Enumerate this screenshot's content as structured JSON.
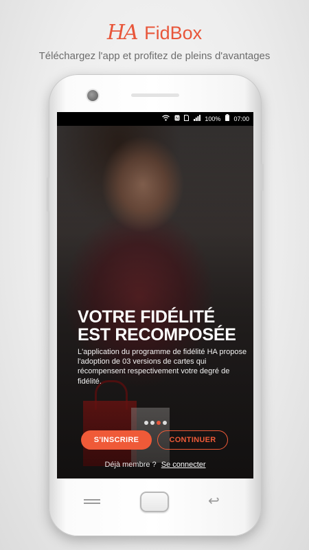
{
  "brand": {
    "logo_text": "HA",
    "name": "FidBox",
    "tagline": "Téléchargez l'app et profitez de pleins d'avantages"
  },
  "status_bar": {
    "battery": "100%",
    "time": "07:00",
    "icons": [
      "wifi-icon",
      "nfc-icon",
      "sim-icon",
      "signal-icon",
      "battery-icon"
    ]
  },
  "onboarding": {
    "headline": "VOTRE FIDÉLITÉ EST RECOMPOSÉE",
    "description": "L'application du programme de fidélité HA propose l'adoption de 03 versions de cartes qui récompensent respectivement votre degré de fidélité.",
    "pager": {
      "total": 4,
      "active": 3
    }
  },
  "actions": {
    "signup_label": "S'INSCRIRE",
    "continue_label": "CONTINUER"
  },
  "login_prompt": {
    "text": "Déjà membre ?",
    "link": "Se connecter"
  },
  "colors": {
    "accent": "#ef5a38",
    "tagline": "#6c6c6c"
  },
  "nav_icons": [
    "recent-apps-icon",
    "home-button",
    "back-icon"
  ]
}
